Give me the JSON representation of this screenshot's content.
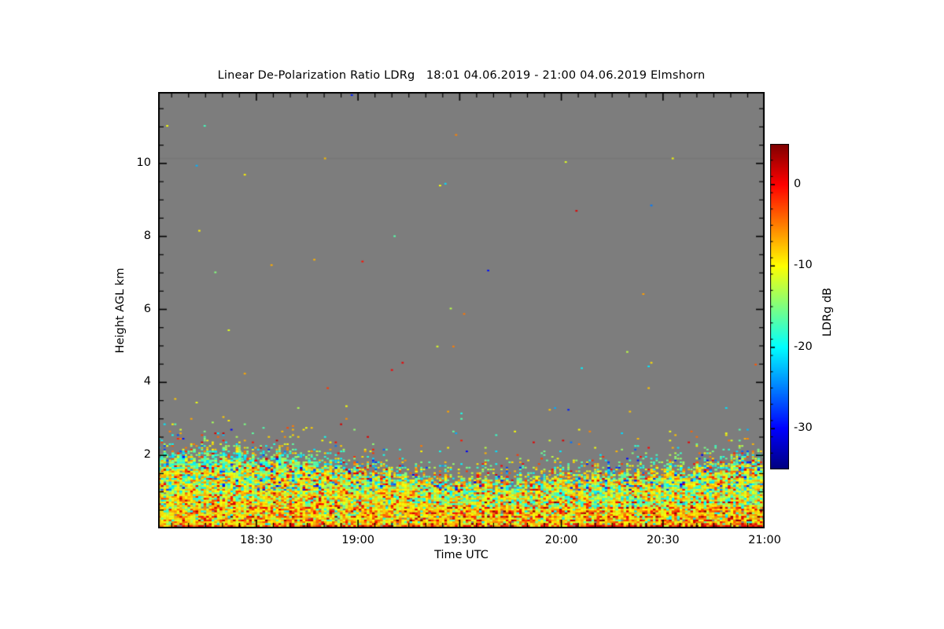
{
  "page": {
    "background": "#ffffff"
  },
  "chart": {
    "title": "Linear De-Polarization Ratio LDRg   18:01 04.06.2019 - 21:00 04.06.2019 Elmshorn",
    "xlabel": "Time UTC",
    "ylabel": "Height AGL km",
    "colorbar_label": "LDRg dB"
  },
  "chart_data": {
    "type": "heatmap",
    "title": "Linear De-Polarization Ratio LDRg   18:01 04.06.2019 - 21:00 04.06.2019 Elmshorn",
    "quantity": "Linear De-Polarization Ratio LDRg",
    "location": "Elmshorn",
    "time_start": "18:01 04.06.2019",
    "time_end": "21:00 04.06.2019",
    "x_axis": {
      "label": "Time UTC",
      "total_minutes": 179,
      "major_ticks": [
        {
          "label": "18:30",
          "minutes": 29
        },
        {
          "label": "19:00",
          "minutes": 59
        },
        {
          "label": "19:30",
          "minutes": 89
        },
        {
          "label": "20:00",
          "minutes": 119
        },
        {
          "label": "20:30",
          "minutes": 149
        },
        {
          "label": "21:00",
          "minutes": 179
        }
      ],
      "minor_tick_step_minutes": 5,
      "minor_tick_first_minute": 4
    },
    "y_axis": {
      "label": "Height AGL km",
      "range_km": [
        0,
        11.957
      ],
      "major_ticks": [
        {
          "label": "2",
          "km": 2
        },
        {
          "label": "4",
          "km": 4
        },
        {
          "label": "6",
          "km": 6
        },
        {
          "label": "8",
          "km": 8
        },
        {
          "label": "10",
          "km": 10
        }
      ],
      "minor_tick_step_km": 0.5
    },
    "colorbar": {
      "label": "LDRg dB",
      "value_top_db": 5,
      "value_bottom_db": -35,
      "major_ticks": [
        {
          "label": "0",
          "db": 0
        },
        {
          "label": "-10",
          "db": -10
        },
        {
          "label": "-20",
          "db": -20
        },
        {
          "label": "-30",
          "db": -30
        }
      ],
      "minor_tick_step_db": 2,
      "colormap": "jet"
    },
    "no_data_color": "#7d7d7d",
    "axis_color": "#000000",
    "description": "Radar depolarization-ratio time/height field: dense speckled echo below ~2 km (yellow/orange ~-10 to -5 dB with red streaks ~0 dB near ground and cyan/green ~-15 to -20 dB layers), thinning to isolated specks above; gray = no data",
    "noise_field": {
      "seed": 1337,
      "cell_w": 3.4,
      "cell_h": 2.3,
      "dense_fill_prob": 0.97,
      "fade_scale_km": 0.27,
      "top_jitter_km": 0.16,
      "dense_top_profile": [
        [
          0.0,
          2.08
        ],
        [
          0.1,
          2.12
        ],
        [
          0.2,
          2.0
        ],
        [
          0.28,
          1.88
        ],
        [
          0.36,
          1.6
        ],
        [
          0.46,
          1.42
        ],
        [
          0.58,
          1.38
        ],
        [
          0.68,
          1.48
        ],
        [
          0.78,
          1.58
        ],
        [
          0.88,
          1.72
        ],
        [
          1.0,
          1.88
        ]
      ],
      "sparse_band": {
        "top_km": 3.3,
        "prob": 0.006
      },
      "high_specks": {
        "top_km": 11.9,
        "prob": 0.0009
      },
      "palette_db": {
        "darkred": [
          3.5,
          1.5
        ],
        "red": [
          -0.5,
          2.5
        ],
        "orange": [
          -5,
          2
        ],
        "yellow": [
          -9.5,
          2.5
        ],
        "green": [
          -14.5,
          2
        ],
        "cyan": [
          -19,
          2.5
        ],
        "blue": [
          -26.5,
          4
        ]
      },
      "height_bands": [
        {
          "h": [
            0,
            0.1
          ],
          "weights": {
            "yellow": 0.35,
            "orange": 0.3,
            "red": 0.25,
            "darkred": 0.1
          }
        },
        {
          "h": [
            0.1,
            0.55
          ],
          "weights": {
            "yellow": 0.58,
            "orange": 0.22,
            "red": 0.08,
            "green": 0.07,
            "cyan": 0.05
          }
        },
        {
          "h": [
            0.55,
            1.05
          ],
          "weights": {
            "yellow": 0.52,
            "orange": 0.14,
            "green": 0.14,
            "cyan": 0.1,
            "red": 0.1
          }
        },
        {
          "h": [
            1.05,
            1.65
          ],
          "weights": {
            "yellow": 0.4,
            "green": 0.18,
            "cyan": 0.18,
            "orange": 0.1,
            "red": 0.08,
            "blue": 0.06
          }
        },
        {
          "h": [
            1.65,
            2.35
          ],
          "weights": {
            "yellow": 0.24,
            "green": 0.24,
            "cyan": 0.28,
            "orange": 0.08,
            "red": 0.07,
            "blue": 0.09
          }
        },
        {
          "h": [
            2.35,
            12
          ],
          "weights": {
            "yellow": 0.3,
            "orange": 0.2,
            "cyan": 0.15,
            "green": 0.13,
            "red": 0.13,
            "blue": 0.09
          }
        }
      ],
      "red_streak_rows_km": [
        0.03,
        0.1,
        0.24,
        0.33,
        0.45,
        0.57,
        0.7
      ],
      "streak_intensity": [
        0.75,
        0.3,
        0.45,
        0.35,
        0.3,
        0.28,
        0.22
      ],
      "aqua_band_left": {
        "t": [
          0,
          0.32
        ],
        "h": [
          1.72,
          2.1
        ],
        "prob": 0.5
      },
      "green_band_right": {
        "t": [
          0.42,
          1.0
        ],
        "h": [
          0.62,
          1.05
        ],
        "prob": 0.3
      },
      "faint_line_km": 10.15
    }
  }
}
